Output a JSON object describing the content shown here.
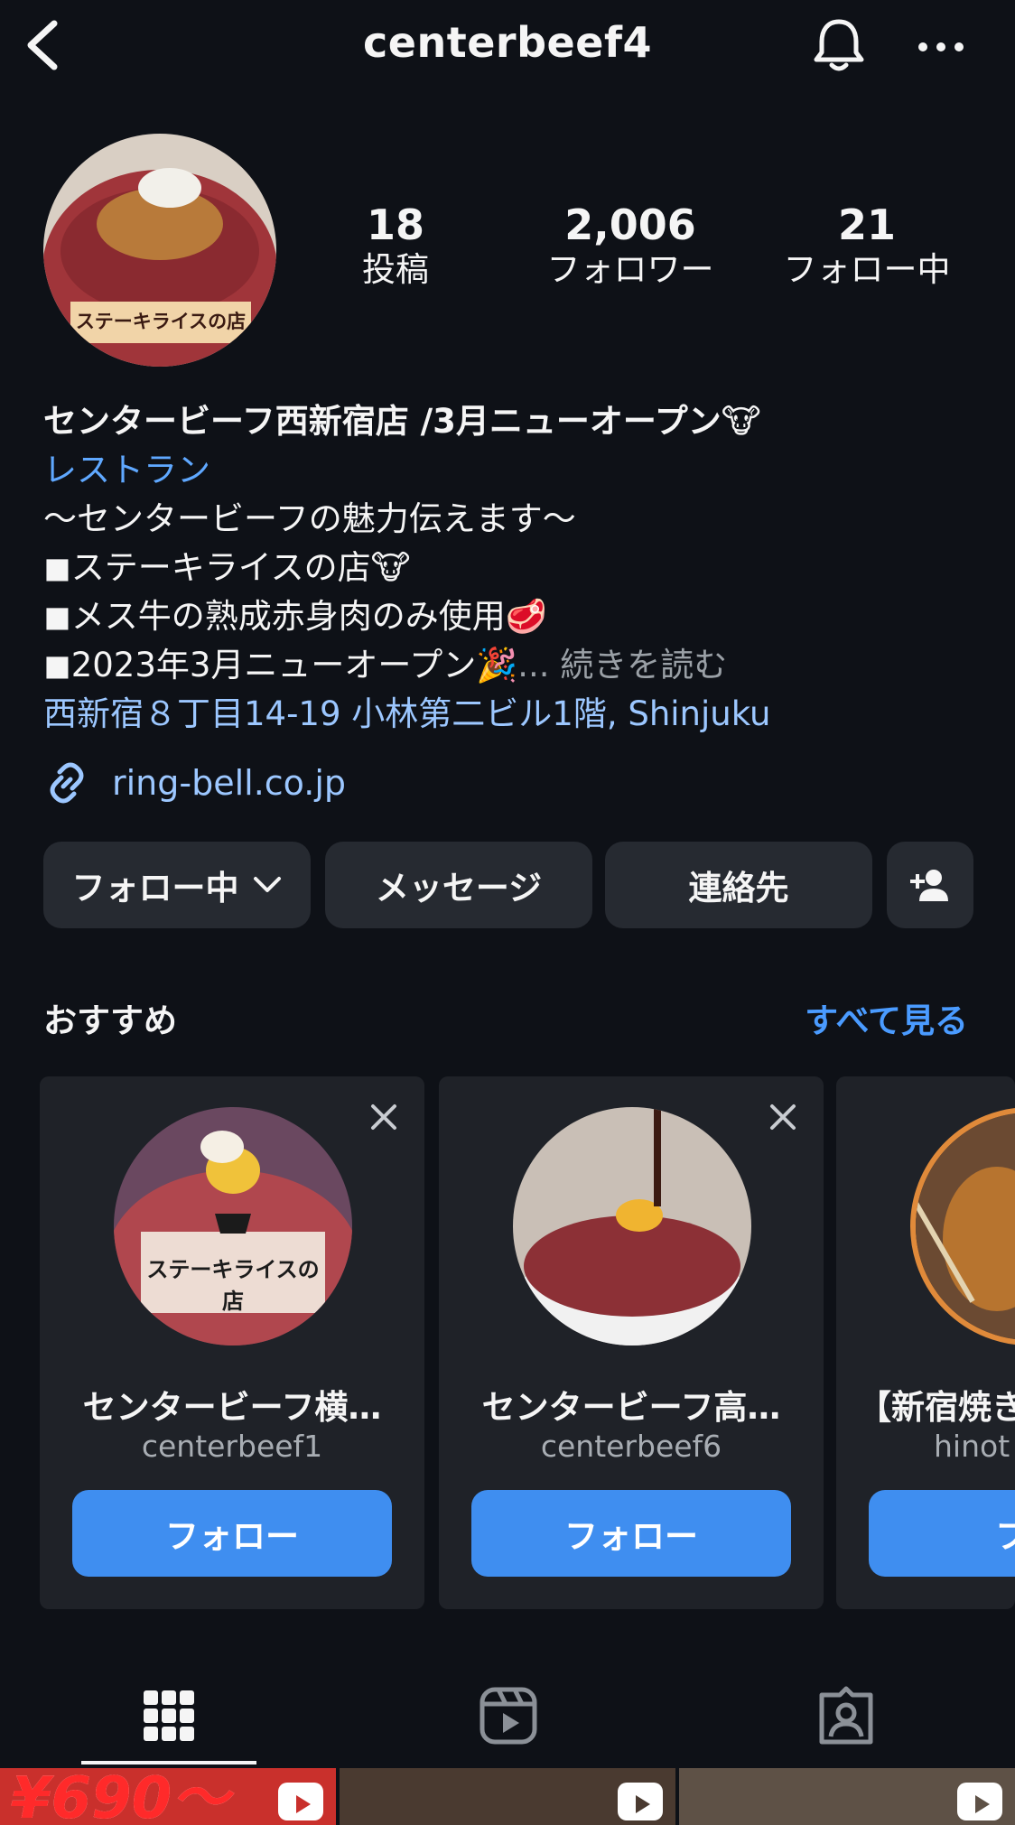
{
  "header": {
    "username": "centerbeef4"
  },
  "profile": {
    "avatar_label": "ステーキライスの店",
    "stats": [
      {
        "value": "18",
        "label": "投稿"
      },
      {
        "value": "2,006",
        "label": "フォロワー"
      },
      {
        "value": "21",
        "label": "フォロー中"
      }
    ],
    "bio": {
      "name": "センタービーフ西新宿店 /3月ニューオープン🐮",
      "category": "レストラン",
      "lines": [
        "〜センタービーフの魅力伝えます〜",
        "◼ステーキライスの店🐮",
        "◼メス牛の熟成赤身肉のみ使用🥩",
        "◼2023年3月ニューオープン🎉"
      ],
      "more": "... 続きを読む",
      "address": "西新宿８丁目14-19 小林第二ビル1階, Shinjuku",
      "link": "ring-bell.co.jp"
    }
  },
  "actions": {
    "following": "フォロー中",
    "message": "メッセージ",
    "contact": "連絡先"
  },
  "suggestions": {
    "title": "おすすめ",
    "see_all": "すべて見る",
    "cards": [
      {
        "name": "センタービーフ横…",
        "handle": "centerbeef1",
        "follow": "フォロー",
        "avatar_text": "ステーキライスの店"
      },
      {
        "name": "センタービーフ高…",
        "handle": "centerbeef6",
        "follow": "フォロー"
      },
      {
        "name": "【新宿焼き",
        "handle": "hinot",
        "follow": "フォ"
      }
    ]
  },
  "posts": {
    "first_price": "¥690〜"
  },
  "colors": {
    "background": "#0e1117",
    "accent": "#3f8ef0",
    "link": "#9cc7ff"
  }
}
